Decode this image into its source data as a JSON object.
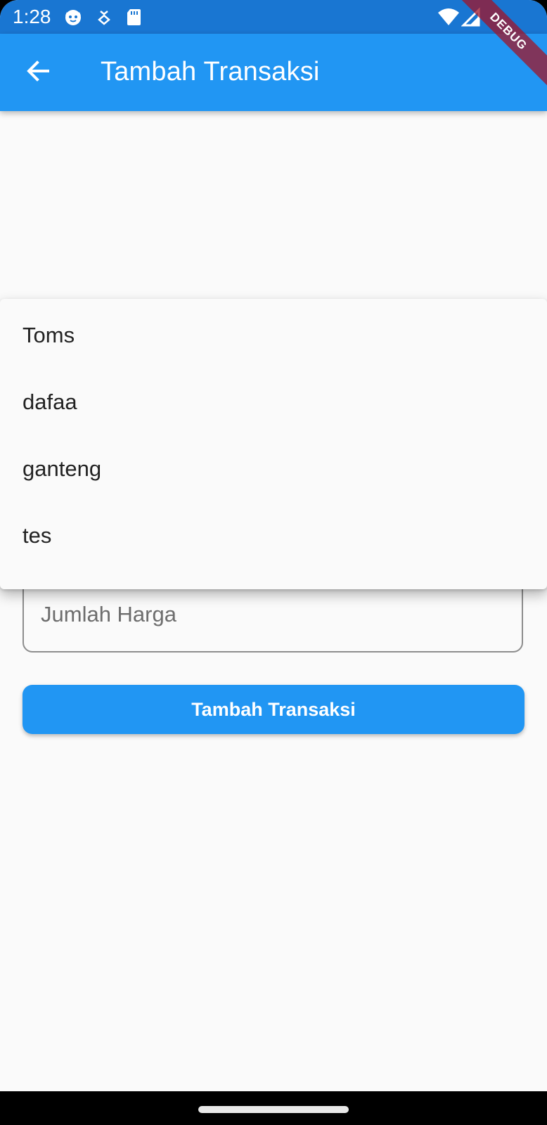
{
  "status_bar": {
    "time": "1:28",
    "icons": [
      "cat-face-icon",
      "android-debug-icon",
      "sd-card-icon",
      "wifi-icon",
      "cell-signal-icon"
    ]
  },
  "app_bar": {
    "title": "Tambah Transaksi",
    "back_icon": "arrow-back-icon",
    "color": "#2196f3"
  },
  "debug_banner": {
    "label": "DEBUG"
  },
  "dropdown": {
    "items": [
      "Toms",
      "dafaa",
      "ganteng",
      "tes"
    ]
  },
  "form": {
    "price_placeholder": "Jumlah Harga",
    "submit_label": "Tambah Transaksi",
    "accent": "#2196f3"
  }
}
